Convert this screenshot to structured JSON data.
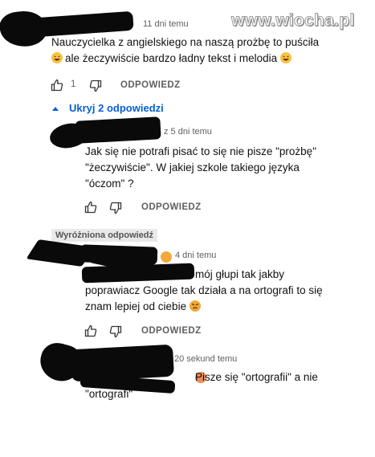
{
  "watermark": "www.wiocha.pl",
  "comment1": {
    "time": "11 dni temu",
    "text_line1": "Nauczycielka z angielskiego na naszą prożbę to puściła",
    "text_line2": "ale żeczywiście bardzo ładny tekst i melodia",
    "likes": "1",
    "reply_label": "ODPOWIEDZ"
  },
  "hide_replies_label": "Ukryj 2 odpowiedzi",
  "reply1": {
    "time": "z  5 dni temu",
    "text_lines": [
      "Jak się nie potrafi pisać to się nie pisze \"prożbę\"",
      "\"żeczywiście\". W jakiej szkole takiego języka",
      "\"óczom\" ?"
    ],
    "reply_label": "ODPOWIEDZ"
  },
  "reply2": {
    "badge": "Wyróżniona odpowiedź",
    "time": "4 dni temu",
    "text_lines": [
      "mój głupi tak jakby",
      "poprawiacz Google tak działa a na ortografi to się",
      "znam lepiej od ciebie"
    ],
    "reply_label": "ODPOWIEDZ"
  },
  "reply3": {
    "time": "20 sekund temu",
    "text_line1": "Pisze się \"ortografii\" a nie",
    "text_line2": "\"ortografi\""
  },
  "icons": [
    "thumb-up-icon",
    "thumb-down-icon",
    "caret-up-icon",
    "laughing-emoji-icon",
    "angry-emoji-icon"
  ],
  "colors": {
    "link_blue": "#065fd4",
    "meta_gray": "#606060"
  }
}
